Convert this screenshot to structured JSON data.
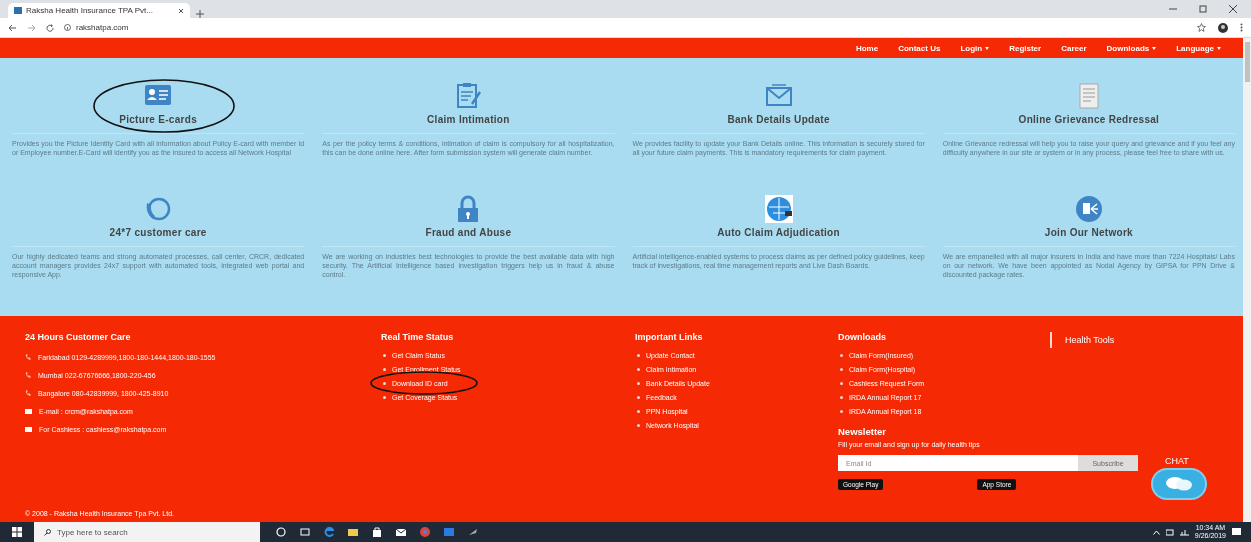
{
  "browser": {
    "tab_title": "Raksha Health Insurance TPA Pvt...",
    "url": "rakshatpa.com"
  },
  "nav": [
    {
      "label": "Home",
      "dropdown": false
    },
    {
      "label": "Contact Us",
      "dropdown": false
    },
    {
      "label": "Login",
      "dropdown": true
    },
    {
      "label": "Register",
      "dropdown": false
    },
    {
      "label": "Career",
      "dropdown": false
    },
    {
      "label": "Downloads",
      "dropdown": true
    },
    {
      "label": "Language",
      "dropdown": true
    }
  ],
  "services": [
    {
      "kind": "id-card",
      "title": "Picture E-cards",
      "circled": true,
      "text": "Provides you the Picture Identity Card with all information about Policy E-card with member Id or Employee number.E-Card will identify you as the insured to access all Network Hospital"
    },
    {
      "kind": "clipboard",
      "title": "Claim Intimation",
      "circled": false,
      "text": "As per the policy terms & conditions, intimation of claim is compulsory for all hospitalization, this can be done online here. After form submission system will generate claim number."
    },
    {
      "kind": "envelope",
      "title": "Bank Details Update",
      "circled": false,
      "text": "We provides facility to update your Bank Details online. This information is securely stored for all your future claim payments. This is mandatory requirements for claim payment."
    },
    {
      "kind": "document",
      "title": "Online Grievance Redressal",
      "circled": false,
      "text": "Online Grievance redressal will help you to raise your query and grievance and if you feel any difficulty anywhere in our site or system or in any process, please feel free to share with us."
    },
    {
      "kind": "phone-24",
      "title": "24*7 customer care",
      "circled": false,
      "text": "Our highly dedicated teams and strong automated processes, call center, CRCR, dedicated account managers provides 24x7 support with automated tools, integrated web portal and responsive App."
    },
    {
      "kind": "padlock",
      "title": "Fraud and Abuse",
      "circled": false,
      "text": "We are working on industries best technologies to provide the best available data with high security. The Artificial Intelligence based investigation triggers help us in fraud & abuse control."
    },
    {
      "kind": "globe",
      "title": "Auto Claim Adjudication",
      "circled": false,
      "text": "Artificial intelligence-enabled systems to process claims as per defined policy guidelines, keep track of investigations, real time management reports and Live Dash Boards."
    },
    {
      "kind": "network",
      "title": "Join Our Network",
      "circled": false,
      "text": "We are empanelled with all major insurers in India and have more than 7224 Hospitals/ Labs on our network. We have been appointed as Nodal Agency by GIPSA for PPN Drive & discounted package rates."
    }
  ],
  "footer": {
    "care": {
      "title": "24 Hours Customer Care",
      "items": [
        {
          "kind": "phone",
          "text": "Faridabad 0129-4289999,1800-180-1444,1800-180-1555"
        },
        {
          "kind": "phone",
          "text": "Mumbai 022-67676666,1800-220-456"
        },
        {
          "kind": "phone",
          "text": "Bangalore 080-42839999, 1800-425-8910"
        },
        {
          "kind": "mail",
          "text": "E-mail : crcm@rakshatpa.com"
        },
        {
          "kind": "mail",
          "text": "For Cashless : cashless@rakshatpa.com"
        }
      ]
    },
    "columns": [
      {
        "title": "Real Time Status",
        "links": [
          {
            "text": "Get Claim Status",
            "circled": false
          },
          {
            "text": "Get Enrollment Status",
            "circled": false
          },
          {
            "text": "Download ID card",
            "circled": true
          },
          {
            "text": "Get Coverage Status",
            "circled": false
          }
        ]
      },
      {
        "title": "Important Links",
        "links": [
          {
            "text": "Update Contact",
            "circled": false
          },
          {
            "text": "Claim Intimation",
            "circled": false
          },
          {
            "text": "Bank Details Update",
            "circled": false
          },
          {
            "text": "Feedback",
            "circled": false
          },
          {
            "text": "PPN Hospital",
            "circled": false
          },
          {
            "text": "Network Hospital",
            "circled": false
          }
        ]
      },
      {
        "title": "Downloads",
        "links": [
          {
            "text": "Claim Form(Insured)",
            "circled": false
          },
          {
            "text": "Claim Form(Hospital)",
            "circled": false
          },
          {
            "text": "Cashless Request Form",
            "circled": false
          },
          {
            "text": "IRDA Annual Report 17",
            "circled": false
          },
          {
            "text": "IRDA Annual Report 18",
            "circled": false
          }
        ]
      }
    ],
    "newsletter": {
      "title": "Newsletter",
      "text": "Fill your email and sign up for daily health tips",
      "placeholder": "Email Id",
      "button": "Subscribe",
      "stores": [
        "Google Play",
        "App Store"
      ]
    },
    "health_tools": "Health Tools",
    "copyright": "© 2008 - Raksha Health Insurance Tpa Pvt. Ltd."
  },
  "chat": {
    "label": "CHAT"
  },
  "taskbar": {
    "search_placeholder": "Type here to search",
    "time": "10:34 AM",
    "date": "9/26/2019"
  }
}
